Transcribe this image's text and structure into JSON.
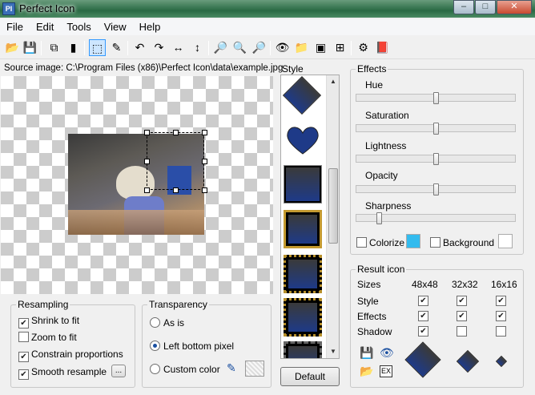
{
  "window": {
    "title": "Perfect Icon",
    "app_icon_text": "PI",
    "buttons": [
      "–",
      "□",
      "✕"
    ]
  },
  "menu": [
    "File",
    "Edit",
    "Tools",
    "View",
    "Help"
  ],
  "toolbar": [
    {
      "name": "open-folder-icon",
      "glyph": "📂"
    },
    {
      "name": "save-icon",
      "glyph": "💾"
    },
    {
      "name": "copy-icon",
      "glyph": "⧉"
    },
    {
      "name": "paste-icon",
      "glyph": "▮"
    },
    {
      "name": "select-rect-icon",
      "glyph": "⬚",
      "active": true
    },
    {
      "name": "eyedropper-icon",
      "glyph": "✎"
    },
    {
      "name": "rotate-left-icon",
      "glyph": "↶"
    },
    {
      "name": "rotate-right-icon",
      "glyph": "↷"
    },
    {
      "name": "flip-horizontal-icon",
      "glyph": "↔"
    },
    {
      "name": "flip-vertical-icon",
      "glyph": "↕"
    },
    {
      "name": "zoom-in-icon",
      "glyph": "🔎"
    },
    {
      "name": "zoom-out-icon",
      "glyph": "🔍"
    },
    {
      "name": "zoom-fit-icon",
      "glyph": "🔎"
    },
    {
      "name": "preview-eye-icon",
      "glyph": "👁"
    },
    {
      "name": "open-icon-icon",
      "glyph": "📁"
    },
    {
      "name": "export-exe-icon",
      "glyph": "▣"
    },
    {
      "name": "windows-logo-icon",
      "glyph": "⊞"
    },
    {
      "name": "options-icon",
      "glyph": "⚙"
    },
    {
      "name": "about-book-icon",
      "glyph": "📕"
    }
  ],
  "source": {
    "label": "Source image: C:\\Program Files (x86)\\Perfect Icon\\data\\example.jpg"
  },
  "resampling": {
    "legend": "Resampling",
    "options": [
      {
        "label": "Shrink to fit",
        "checked": true
      },
      {
        "label": "Zoom to fit",
        "checked": false
      },
      {
        "label": "Constrain proportions",
        "checked": true
      },
      {
        "label": "Smooth resample",
        "checked": true
      }
    ],
    "more_button": "..."
  },
  "transparency": {
    "legend": "Transparency",
    "options": [
      {
        "label": "As is",
        "selected": false
      },
      {
        "label": "Left bottom pixel",
        "selected": true
      },
      {
        "label": "Custom color",
        "selected": false
      }
    ]
  },
  "style": {
    "label": "Style",
    "default_button": "Default",
    "thumbnails": [
      "diamond",
      "heart",
      "square",
      "square-gold-frame",
      "square-dotted-frame",
      "square-dotted-frame",
      "square-film-frame"
    ]
  },
  "effects": {
    "legend": "Effects",
    "sliders": [
      {
        "label": "Hue",
        "value": 0.5
      },
      {
        "label": "Saturation",
        "value": 0.5
      },
      {
        "label": "Lightness",
        "value": 0.5
      },
      {
        "label": "Opacity",
        "value": 0.5
      },
      {
        "label": "Sharpness",
        "value": 0.13
      }
    ],
    "colorize": {
      "label": "Colorize",
      "checked": false,
      "color": "#33bbee"
    },
    "background": {
      "label": "Background",
      "checked": false,
      "color": "#ffffff"
    }
  },
  "result": {
    "legend": "Result icon",
    "sizes_label": "Sizes",
    "columns": [
      "48x48",
      "32x32",
      "16x16"
    ],
    "rows": [
      {
        "label": "Style",
        "values": [
          true,
          true,
          true
        ]
      },
      {
        "label": "Effects",
        "values": [
          true,
          true,
          true
        ]
      },
      {
        "label": "Shadow",
        "values": [
          true,
          false,
          false
        ]
      }
    ]
  }
}
